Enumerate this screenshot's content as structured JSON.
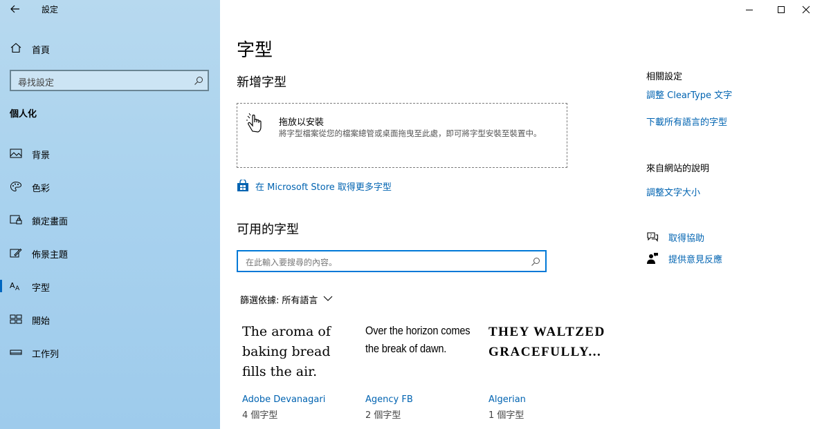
{
  "window": {
    "title": "設定",
    "controls": {
      "minimize": "minimize-icon",
      "maximize": "maximize-icon",
      "close": "close-icon"
    }
  },
  "sidebar": {
    "home_label": "首頁",
    "search_placeholder": "尋找設定",
    "section_title": "個人化",
    "items": [
      {
        "label": "背景",
        "icon": "picture-icon"
      },
      {
        "label": "色彩",
        "icon": "palette-icon"
      },
      {
        "label": "鎖定畫面",
        "icon": "lock-screen-icon"
      },
      {
        "label": "佈景主題",
        "icon": "brush-icon"
      },
      {
        "label": "字型",
        "icon": "font-icon",
        "active": true
      },
      {
        "label": "開始",
        "icon": "start-icon"
      },
      {
        "label": "工作列",
        "icon": "taskbar-icon"
      }
    ]
  },
  "main": {
    "title": "字型",
    "add_fonts_heading": "新增字型",
    "dropzone": {
      "title": "拖放以安裝",
      "description": "將字型檔案從您的檔案總管或桌面拖曳至此處，即可將字型安裝至裝置中。"
    },
    "store_link": "在 Microsoft Store 取得更多字型",
    "available_heading": "可用的字型",
    "font_search_placeholder": "在此輸入要搜尋的內容。",
    "filter_label": "篩選依據:",
    "filter_value": "所有語言",
    "fonts": [
      {
        "sample": "The aroma of baking bread fills the air.",
        "name": "Adobe Devanagari",
        "count": "4 個字型"
      },
      {
        "sample": "Over the horizon comes the break of dawn.",
        "name": "Agency FB",
        "count": "2 個字型"
      },
      {
        "sample": "THEY WALTZED GRACEFULLY...",
        "name": "Algerian",
        "count": "1 個字型"
      }
    ]
  },
  "right": {
    "related_heading": "相關設定",
    "related_links": [
      "調整 ClearType 文字",
      "下載所有語言的字型"
    ],
    "web_help_heading": "來自網站的說明",
    "web_help_links": [
      "調整文字大小"
    ],
    "get_help": "取得協助",
    "feedback": "提供意見反應"
  },
  "colors": {
    "accent": "#0063b1",
    "sidebar_bg": "#a9d2ee",
    "focus_border": "#0078d7"
  }
}
